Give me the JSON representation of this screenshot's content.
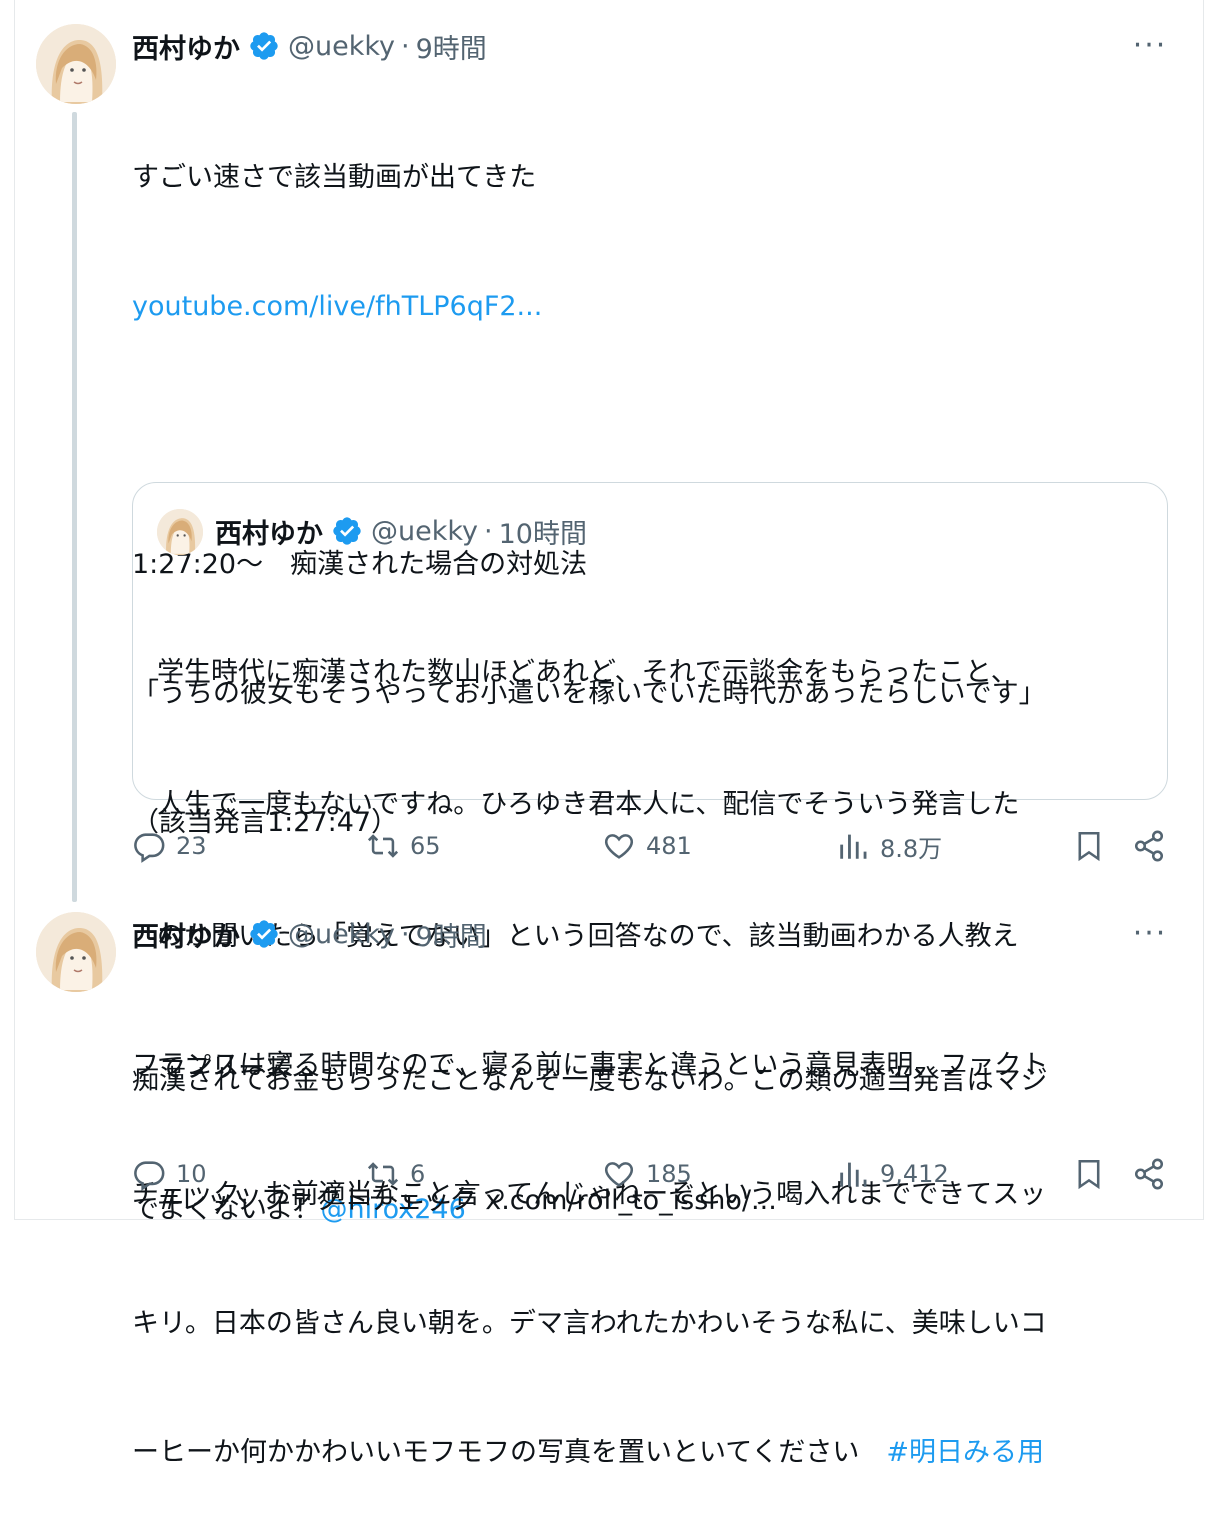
{
  "tweets": [
    {
      "author_name": "西村ゆか",
      "handle": "@uekky",
      "separator": "·",
      "time": "9時間",
      "more": "···",
      "lines": [
        "すごい速さで該当動画が出てきた"
      ],
      "link": "youtube.com/live/fhTLP6qF2...",
      "body_lines": [
        "1:27:20〜　痴漢された場合の対処法",
        "「うちの彼女もそうやってお小遣いを稼いでいた時代があったらしいです」",
        "（該当発言1:27:47）",
        "",
        "痴漢されてお金もらったことなんぞ一度もないわ。この類の適当発言はマジ"
      ],
      "last_line_text": "でよくないよ！",
      "mention": "@hirox246",
      "quote": {
        "author_name": "西村ゆか",
        "handle": "@uekky",
        "separator": "·",
        "time": "10時間",
        "lines": [
          "学生時代に痴漢された数山ほどあれど、それで示談金をもらったこと、",
          "人生で一度もないですね。ひろゆき君本人に、配信でそういう発言した",
          "のか聞いたら「覚えてない」という回答なので、該当動画わかる人教え",
          "てプリーズ"
        ],
        "hashtag_line": "#レッツファクトチェック",
        "link": "x.com/roll_to_issho/..."
      },
      "stats": {
        "replies": "23",
        "reposts": "65",
        "likes": "481",
        "views": "8.8万"
      }
    },
    {
      "author_name": "西村ゆか",
      "handle": "@uekky",
      "separator": "·",
      "time": "9時間",
      "more": "···",
      "lines": [
        "フランスは寝る時間なので、寝る前に事実と違うという意見表明、ファクト",
        "チェック、お前適当なこと言ってんじゃねーぞという喝入れまでできてスッ",
        "キリ。日本の皆さん良い朝を。デマ言われたかわいそうな私に、美味しいコ"
      ],
      "last_line_text": "ーヒーか何かかわいいモフモフの写真を置いといてください　",
      "hashtag": "#明日みる用",
      "stats": {
        "replies": "10",
        "reposts": "6",
        "likes": "185",
        "views": "9,412"
      }
    }
  ],
  "icons": {
    "verified": "verified-badge-icon",
    "reply": "reply-icon",
    "repost": "repost-icon",
    "like": "heart-icon",
    "views": "views-chart-icon",
    "bookmark": "bookmark-icon",
    "share": "share-icon",
    "more": "more-dots-icon"
  },
  "colors": {
    "link": "#1d9bf0",
    "muted": "#536471",
    "text": "#0f1419",
    "verified": "#1d9bf0"
  }
}
